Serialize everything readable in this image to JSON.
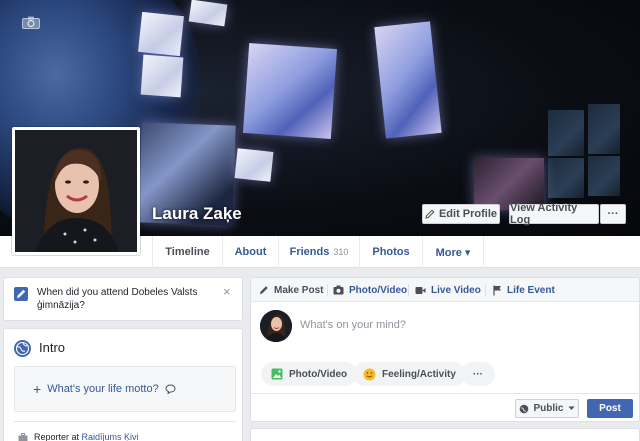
{
  "profile": {
    "name": "Laura Zaķe"
  },
  "cover_actions": {
    "edit_profile": "Edit Profile",
    "view_activity_log": "View Activity Log",
    "more": "···"
  },
  "tabs": [
    {
      "label": "Timeline",
      "count": ""
    },
    {
      "label": "About",
      "count": ""
    },
    {
      "label": "Friends",
      "count": "310"
    },
    {
      "label": "Photos",
      "count": ""
    },
    {
      "label": "More ▾",
      "count": ""
    }
  ],
  "school_prompt": {
    "question": "When did you attend Dobeles Valsts ģimnāzija?",
    "close": "×"
  },
  "intro": {
    "title": "Intro",
    "motto_prompt": "What's your life motto?",
    "work_prefix": "Reporter at ",
    "work_place": "Raidījums Ķivi"
  },
  "composer": {
    "tabs": [
      "Make Post",
      "Photo/Video",
      "Live Video",
      "Life Event"
    ],
    "placeholder": "What's on your mind?",
    "actions": [
      "Photo/Video",
      "Feeling/Activity",
      "···"
    ],
    "privacy": "Public",
    "post_button": "Post"
  },
  "colors": {
    "brand_blue": "#4267b2",
    "link_blue": "#365899",
    "page_bg": "#e9ebee"
  },
  "icons": [
    "camera-icon",
    "pencil-icon",
    "chevron-down-icon",
    "close-icon",
    "globe-icon",
    "plus-icon",
    "speech-bubble-icon",
    "briefcase-icon",
    "photo-icon",
    "video-camera-icon",
    "flag-icon",
    "smiley-icon"
  ]
}
